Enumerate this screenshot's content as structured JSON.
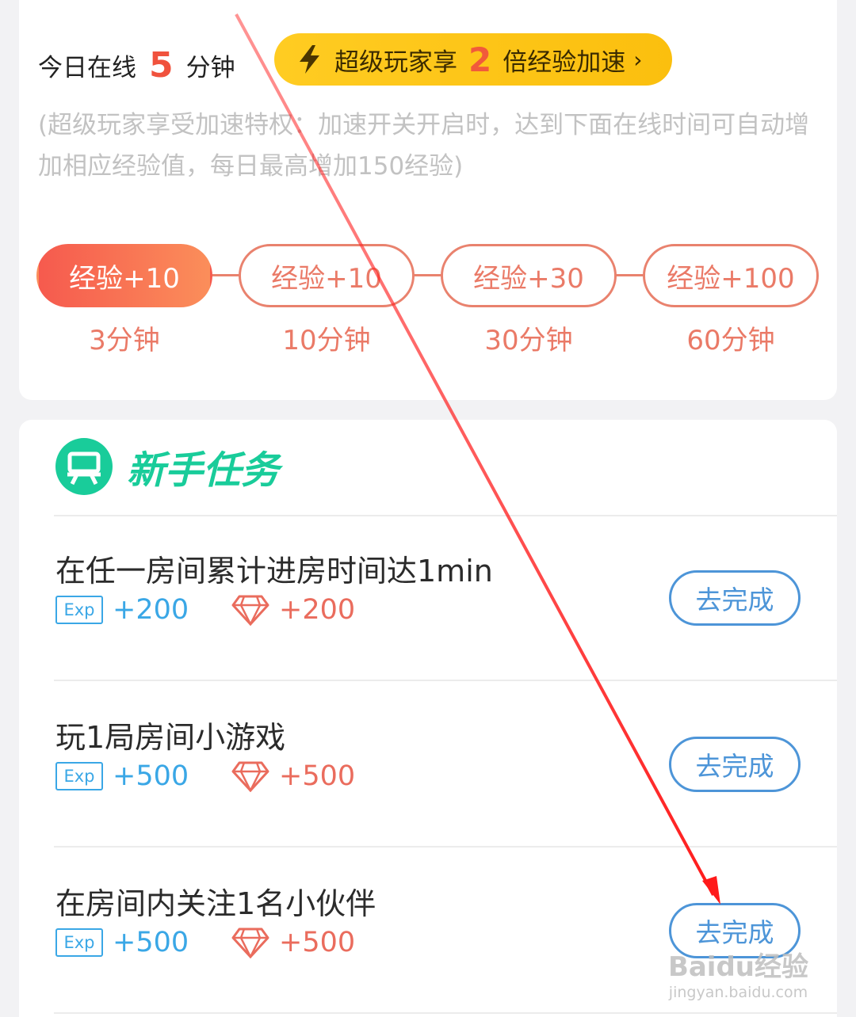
{
  "online": {
    "label_prefix": "今日在线",
    "minutes": "5",
    "label_suffix": "分钟"
  },
  "boost": {
    "prefix": "超级玩家享",
    "multiplier": "2",
    "suffix": "倍经验加速",
    "chevron": "›",
    "color": "#ffcc22"
  },
  "description": "(超级玩家享受加速特权：加速开关开启时，达到下面在线时间可自动增加相应经验值，每日最高增加150经验)",
  "steps": [
    {
      "label": "经验+10",
      "time": "3分钟",
      "active": true
    },
    {
      "label": "经验+10",
      "time": "10分钟",
      "active": false
    },
    {
      "label": "经验+30",
      "time": "30分钟",
      "active": false
    },
    {
      "label": "经验+100",
      "time": "60分钟",
      "active": false
    }
  ],
  "tasks_section": {
    "title": "新手任务",
    "icon": "board-icon",
    "accent": "#19cc9a"
  },
  "tasks": [
    {
      "name": "在任一房间累计进房时间达1min",
      "exp_badge": "Exp",
      "exp": "+200",
      "gem": "+200",
      "button": "去完成"
    },
    {
      "name": "玩1局房间小游戏",
      "exp_badge": "Exp",
      "exp": "+500",
      "gem": "+500",
      "button": "去完成"
    },
    {
      "name": "在房间内关注1名小伙伴",
      "exp_badge": "Exp",
      "exp": "+500",
      "gem": "+500",
      "button": "去完成"
    }
  ],
  "watermark": {
    "brand": "Baidu经验",
    "url": "jingyan.baidu.com"
  }
}
